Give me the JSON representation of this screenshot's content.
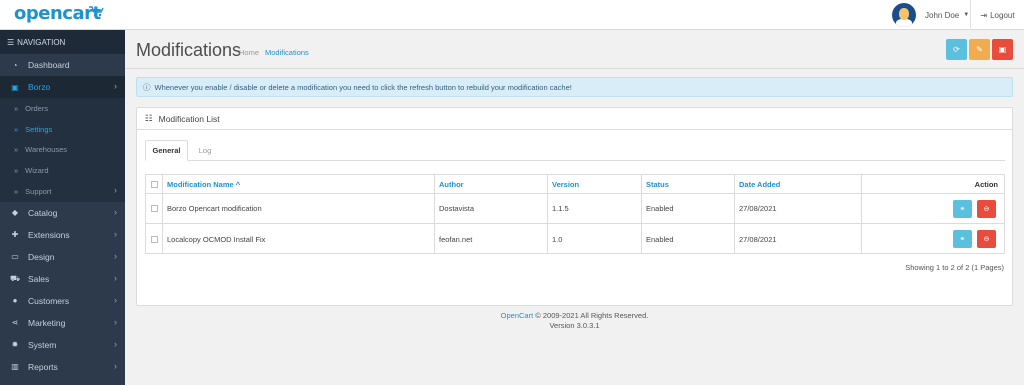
{
  "header": {
    "logo_text": "opencart",
    "user_name": "John Doe",
    "logout_label": "Logout"
  },
  "sidebar": {
    "title": "NAVIGATION",
    "items": [
      {
        "label": "Dashboard",
        "icon": "dashboard-icon"
      },
      {
        "label": "Borzo",
        "icon": "puzzle-icon"
      },
      {
        "label": "Orders"
      },
      {
        "label": "Settings"
      },
      {
        "label": "Warehouses"
      },
      {
        "label": "Wizard"
      },
      {
        "label": "Support"
      },
      {
        "label": "Catalog",
        "icon": "tag-icon"
      },
      {
        "label": "Extensions",
        "icon": "puzzle-icon"
      },
      {
        "label": "Design",
        "icon": "desktop-icon"
      },
      {
        "label": "Sales",
        "icon": "cart-icon"
      },
      {
        "label": "Customers",
        "icon": "user-icon"
      },
      {
        "label": "Marketing",
        "icon": "share-icon"
      },
      {
        "label": "System",
        "icon": "gear-icon"
      },
      {
        "label": "Reports",
        "icon": "bar-chart-icon"
      }
    ]
  },
  "page": {
    "title": "Modifications",
    "breadcrumb": [
      "Home",
      "Modifications"
    ]
  },
  "colors": {
    "info": "#5bc0de",
    "warning": "#f0ad4e",
    "danger": "#e74c3c",
    "link": "#1e91cf",
    "sidebar": "#2c3a4b"
  },
  "alert": {
    "text": "Whenever you enable / disable or delete a modification you need to click the refresh button to rebuild your modification cache!"
  },
  "panel": {
    "title": "Modification List",
    "tabs": [
      "General",
      "Log"
    ]
  },
  "table": {
    "columns": [
      "Modification Name",
      "Author",
      "Version",
      "Status",
      "Date Added",
      "Action"
    ],
    "sort_indicator": "^",
    "rows": [
      {
        "name": "Borzo Opencart modification",
        "author": "Dostavista",
        "version": "1.1.5",
        "status": "Enabled",
        "date": "27/08/2021"
      },
      {
        "name": "Localcopy OCMOD Install Fix",
        "author": "feofan.net",
        "version": "1.0",
        "status": "Enabled",
        "date": "27/08/2021"
      }
    ],
    "pagination": "Showing 1 to 2 of 2 (1 Pages)"
  },
  "footer": {
    "link": "OpenCart",
    "copyright": "© 2009-2021 All Rights Reserved.",
    "version": "Version 3.0.3.1"
  }
}
